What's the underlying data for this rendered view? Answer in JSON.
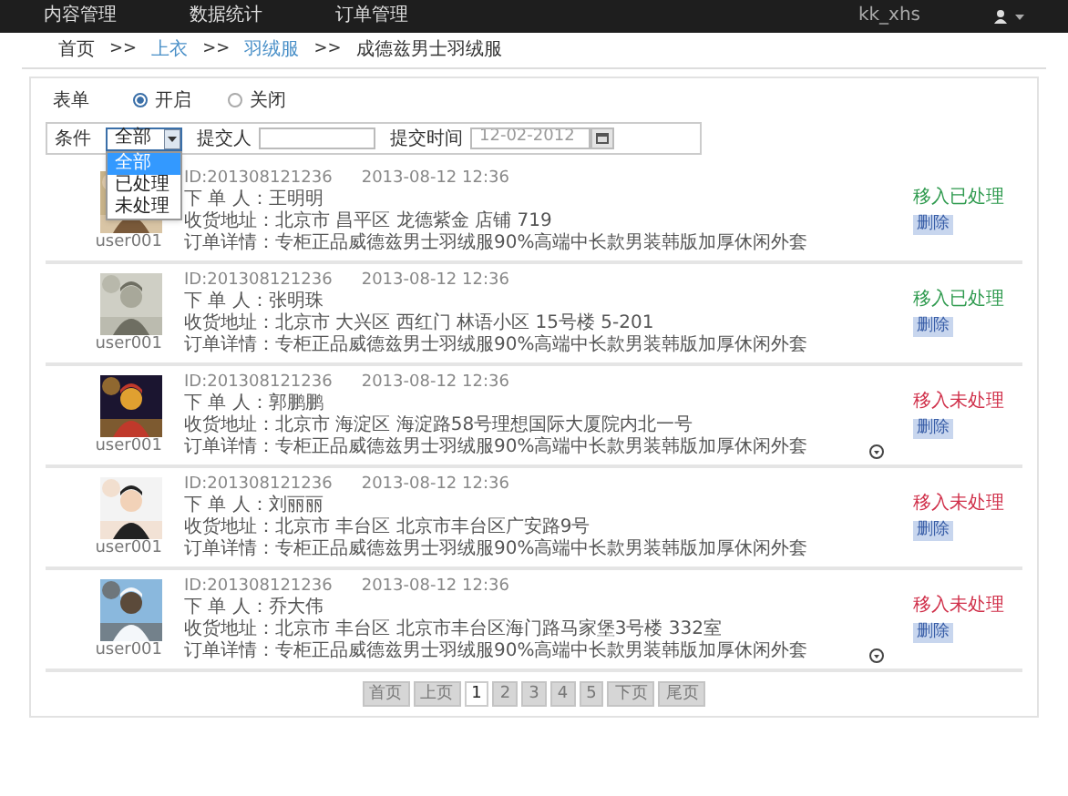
{
  "nav": {
    "items": [
      {
        "label": "内容管理"
      },
      {
        "label": "数据统计"
      },
      {
        "label": "订单管理"
      }
    ],
    "user": "kk_xhs"
  },
  "breadcrumb": [
    {
      "kind": "text",
      "label": "首页"
    },
    {
      "kind": "separator",
      "label": ">>"
    },
    {
      "kind": "link",
      "label": "上衣"
    },
    {
      "kind": "separator",
      "label": ">>"
    },
    {
      "kind": "link",
      "label": "羽绒服"
    },
    {
      "kind": "separator",
      "label": ">>"
    },
    {
      "kind": "text",
      "label": "成德兹男士羽绒服"
    }
  ],
  "form": {
    "label": "表单",
    "options": [
      {
        "label": "开启",
        "selected": true
      },
      {
        "label": "关闭",
        "selected": false
      }
    ]
  },
  "filters": {
    "condition": {
      "label": "条件",
      "value": "全部",
      "expanded": true,
      "options": [
        {
          "label": "全部",
          "selected": true
        },
        {
          "label": "已处理",
          "selected": false
        },
        {
          "label": "未处理",
          "selected": false
        }
      ]
    },
    "submitter": {
      "label": "提交人"
    },
    "time": {
      "label": "提交时间",
      "value": "12-02-2012"
    }
  },
  "orders": [
    {
      "user": "user001",
      "id": "ID:201308121236",
      "date": "2013-08-12 12:36",
      "buyer_label": "下 单 人：",
      "buyer": "王明明",
      "address_label": "收货地址：",
      "address": "北京市 昌平区 龙德紫金 店铺 719",
      "detail_label": "订单详情：",
      "detail": "专柜正品威德兹男士羽绒服90%高端中长款男装韩版加厚休闲外套",
      "action": "移入已处理",
      "processed": true,
      "delete": "删除",
      "expand_icon": false
    },
    {
      "user": "user001",
      "id": "ID:201308121236",
      "date": "2013-08-12 12:36",
      "buyer_label": "下 单 人：",
      "buyer": "张明珠",
      "address_label": "收货地址：",
      "address": "北京市 大兴区 西红门 林语小区 15号楼 5-201",
      "detail_label": "订单详情：",
      "detail": "专柜正品威德兹男士羽绒服90%高端中长款男装韩版加厚休闲外套",
      "action": "移入已处理",
      "processed": true,
      "delete": "删除",
      "expand_icon": false
    },
    {
      "user": "user001",
      "id": "ID:201308121236",
      "date": "2013-08-12 12:36",
      "buyer_label": "下 单 人：",
      "buyer": "郭鹏鹏",
      "address_label": "收货地址：",
      "address": "北京市 海淀区 海淀路58号理想国际大厦院内北一号",
      "detail_label": "订单详情：",
      "detail": "专柜正品威德兹男士羽绒服90%高端中长款男装韩版加厚休闲外套",
      "action": "移入未处理",
      "processed": false,
      "delete": "删除",
      "expand_icon": true
    },
    {
      "user": "user001",
      "id": "ID:201308121236",
      "date": "2013-08-12 12:36",
      "buyer_label": "下 单 人：",
      "buyer": "刘丽丽",
      "address_label": "收货地址：",
      "address": "北京市 丰台区 北京市丰台区广安路9号",
      "detail_label": "订单详情：",
      "detail": "专柜正品威德兹男士羽绒服90%高端中长款男装韩版加厚休闲外套",
      "action": "移入未处理",
      "processed": false,
      "delete": "删除",
      "expand_icon": false
    },
    {
      "user": "user001",
      "id": "ID:201308121236",
      "date": "2013-08-12 12:36",
      "buyer_label": "下 单 人：",
      "buyer": "乔大伟",
      "address_label": "收货地址：",
      "address": "北京市 丰台区 北京市丰台区海门路马家堡3号楼 332室",
      "detail_label": "订单详情：",
      "detail": "专柜正品威德兹男士羽绒服90%高端中长款男装韩版加厚休闲外套",
      "action": "移入未处理",
      "processed": false,
      "delete": "删除",
      "expand_icon": true
    }
  ],
  "pagination": [
    {
      "label": "首页",
      "selected": false
    },
    {
      "label": "上页",
      "selected": false
    },
    {
      "label": "1",
      "selected": true
    },
    {
      "label": "2",
      "selected": false
    },
    {
      "label": "3",
      "selected": false
    },
    {
      "label": "4",
      "selected": false
    },
    {
      "label": "5",
      "selected": false
    },
    {
      "label": "下页",
      "selected": false
    },
    {
      "label": "尾页",
      "selected": false
    }
  ]
}
